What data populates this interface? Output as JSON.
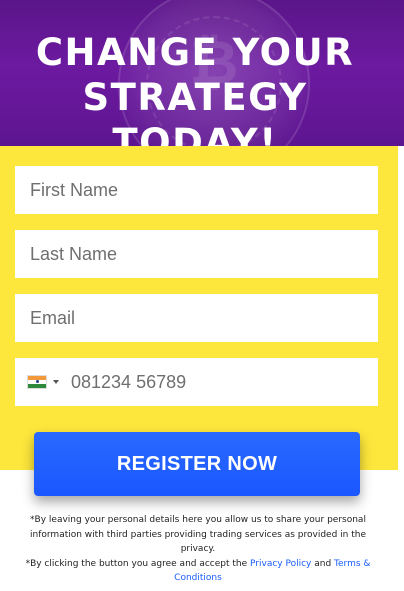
{
  "hero": {
    "headline": "CHANGE YOUR STRATEGY TODAY!",
    "background_color": "#5e1590"
  },
  "form": {
    "panel_color": "#fde73c",
    "first_name_placeholder": "First Name",
    "last_name_placeholder": "Last Name",
    "email_placeholder": "Email",
    "phone": {
      "country_flag": "india-flag-icon",
      "placeholder": "081234 56789"
    },
    "register_label": "REGISTER NOW",
    "button_color": "#1b57ff"
  },
  "disclaimer": {
    "line1": "*By leaving your personal details here you allow us to share your personal information with third parties providing trading services as provided in the privacy.",
    "line2_prefix": "*By clicking the button you agree and accept the ",
    "privacy_link": "Privacy Policy",
    "and_text": " and ",
    "terms_link": "Terms & Conditions"
  }
}
